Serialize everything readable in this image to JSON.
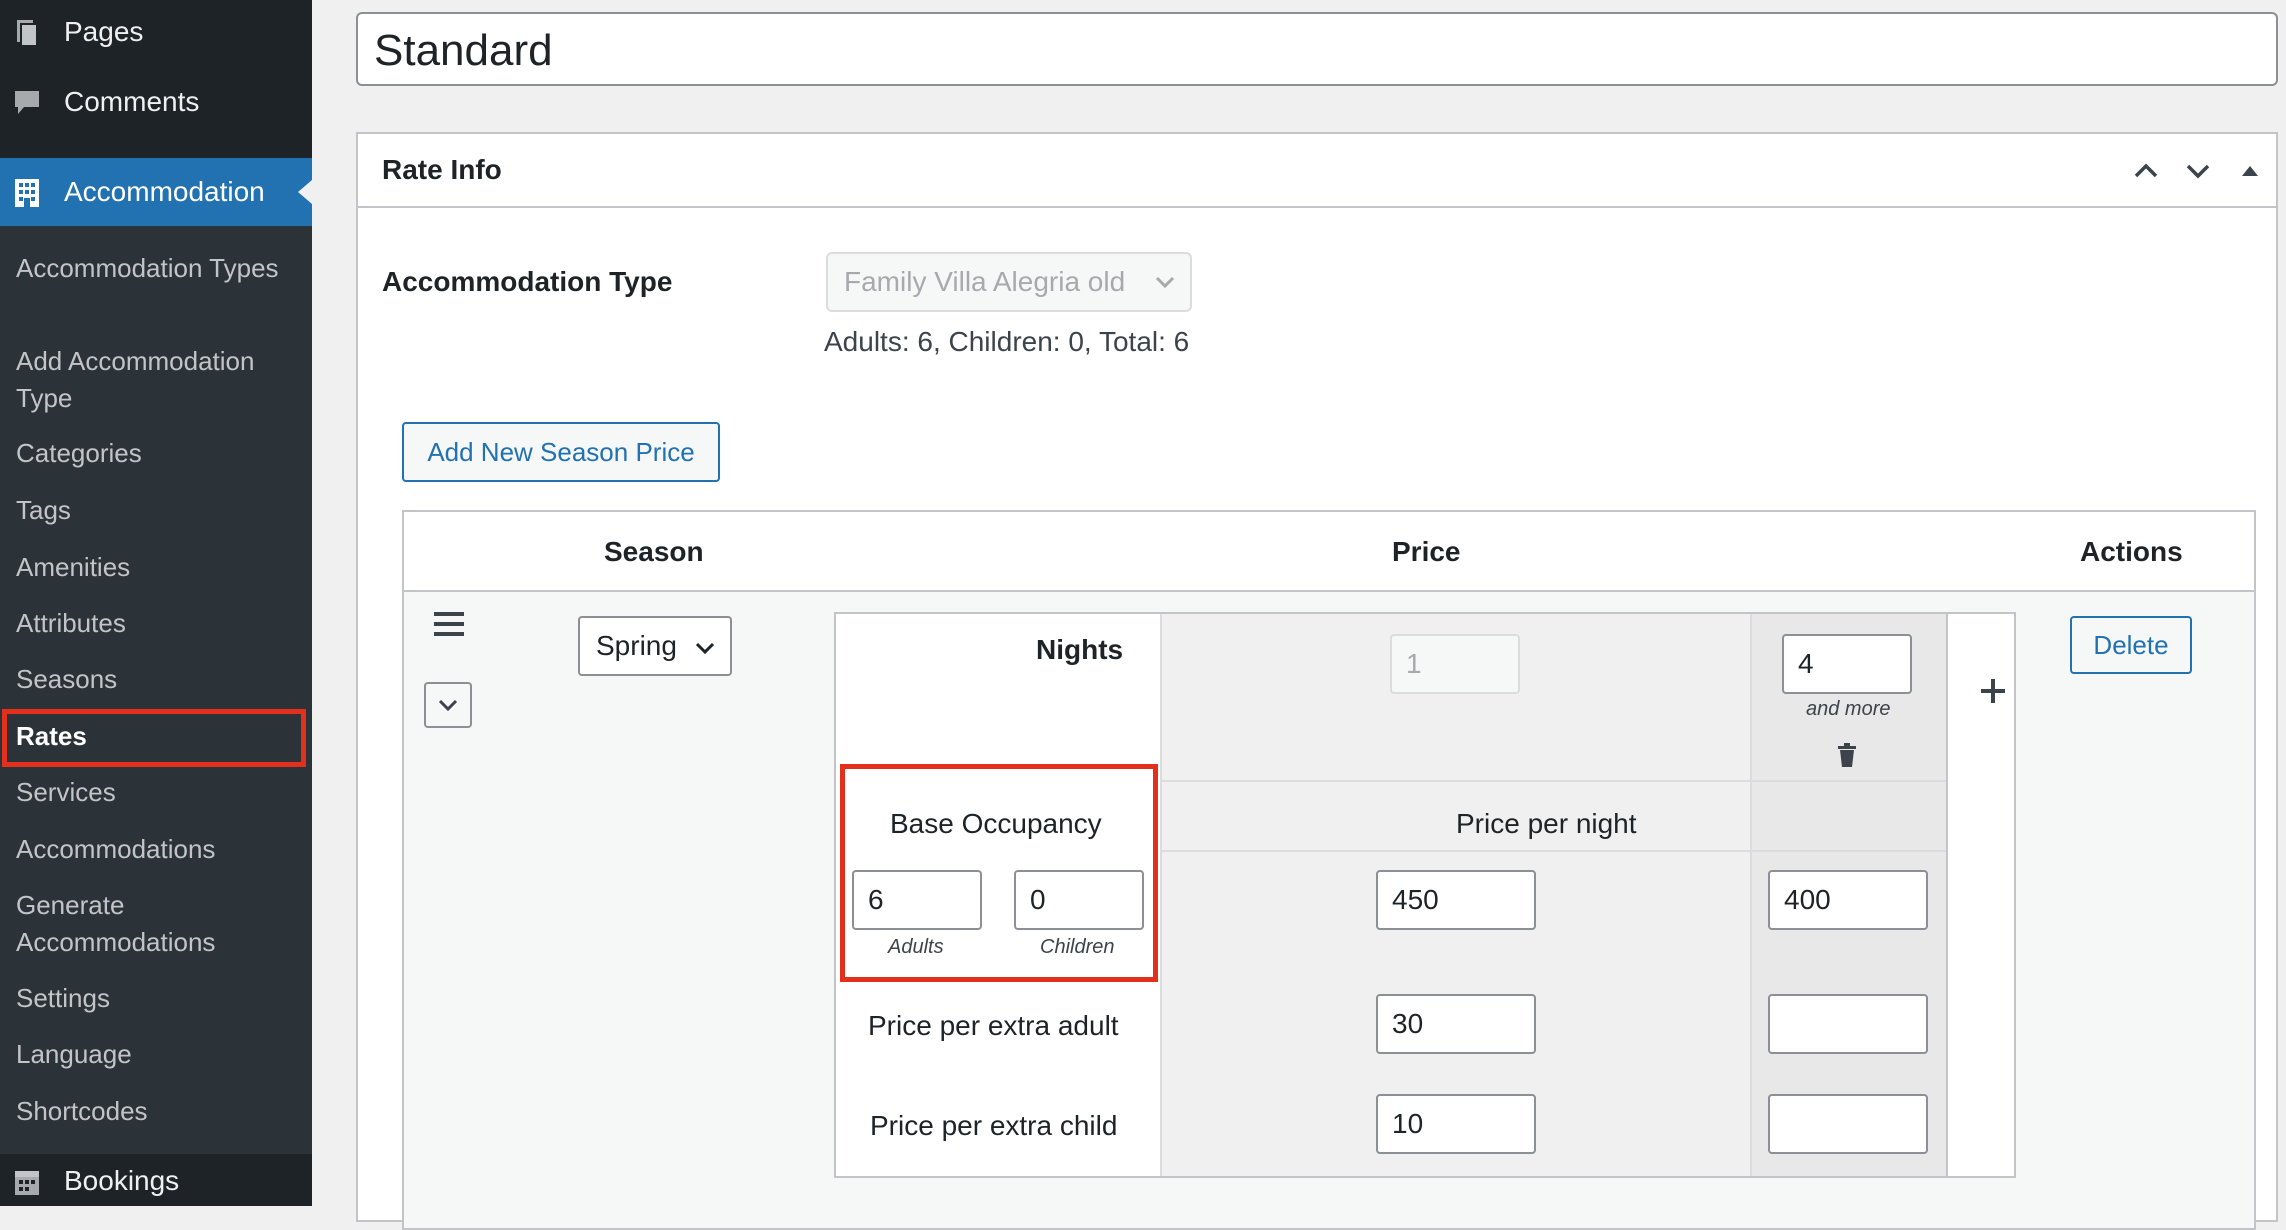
{
  "sidebar": {
    "pages": "Pages",
    "comments": "Comments",
    "accommodation": "Accommodation",
    "submenu": [
      "Accommodation Types",
      "Add Accommodation Type",
      "Categories",
      "Tags",
      "Amenities",
      "Attributes",
      "Seasons",
      "Rates",
      "Services",
      "Accommodations",
      "Generate Accommodations",
      "Settings",
      "Language",
      "Shortcodes"
    ],
    "bookings": "Bookings"
  },
  "title_value": "Standard",
  "panel": {
    "title": "Rate Info",
    "accommodation_type_label": "Accommodation Type",
    "accommodation_type_value": "Family Villa Alegria old",
    "capacity_text": "Adults: 6, Children: 0, Total: 6",
    "add_season_button": "Add New Season Price"
  },
  "table": {
    "headers": {
      "season": "Season",
      "price": "Price",
      "actions": "Actions"
    },
    "season_value": "Spring",
    "delete_button": "Delete",
    "nights_label": "Nights",
    "nights_from": "1",
    "nights_to": "4",
    "and_more": "and more",
    "base_occupancy_label": "Base Occupancy",
    "adults_value": "6",
    "children_value": "0",
    "adults_caption": "Adults",
    "children_caption": "Children",
    "price_per_night_label": "Price per night",
    "price_per_night": [
      "450",
      "400"
    ],
    "extra_adult_label": "Price per extra adult",
    "extra_adult": [
      "30",
      ""
    ],
    "extra_child_label": "Price per extra child",
    "extra_child": [
      "10",
      ""
    ]
  },
  "colors": {
    "accent": "#2271b1",
    "sidebar": "#1d2327",
    "highlight": "#e3301c"
  }
}
